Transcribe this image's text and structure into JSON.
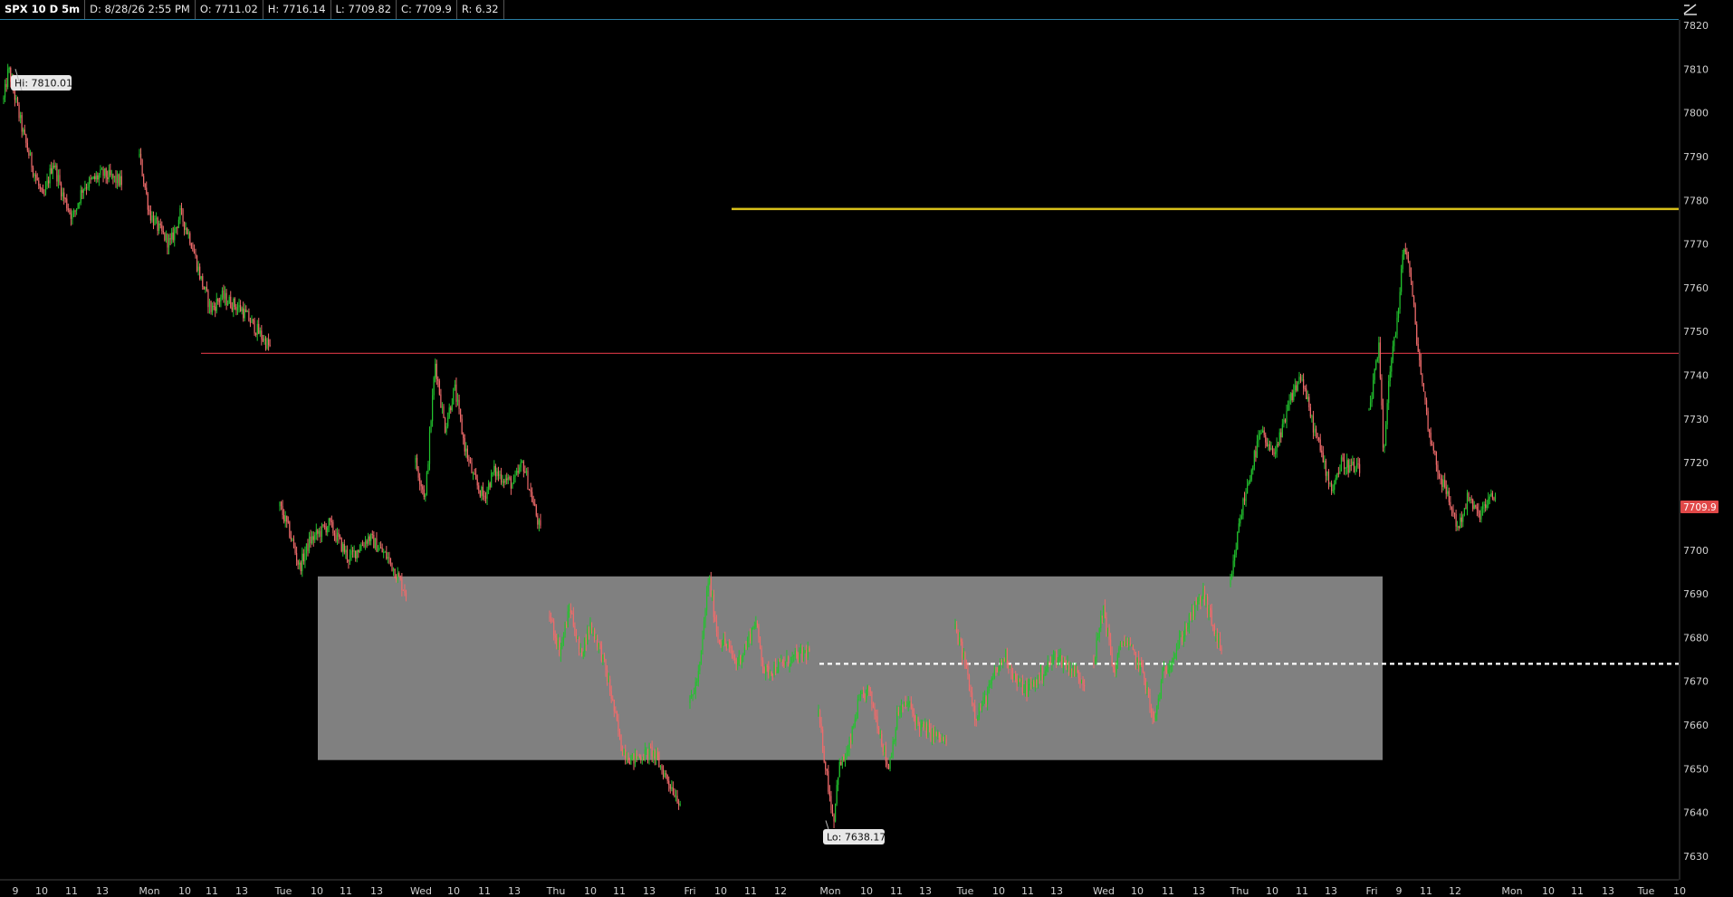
{
  "header": {
    "symbol": "SPX 10 D 5m",
    "date": "D: 8/28/26 2:55 PM",
    "open": "O: 7711.02",
    "high": "H: 7716.14",
    "low": "L: 7709.82",
    "close": "C: 7709.9",
    "range": "R: 6.32"
  },
  "icons": {
    "corner": "drawing-tools-icon"
  },
  "colors": {
    "background": "#000000",
    "up": "#22c32e",
    "down": "#f06b6b",
    "resistance_line": "#d8c01a",
    "support_line": "#c0303c",
    "zone": "#808080",
    "dotted_level": "#ffffff",
    "price_tag": "#e04848"
  },
  "chart_data": {
    "type": "candlestick",
    "title": "SPX 10 D 5m",
    "ylim": [
      7625,
      7830
    ],
    "y_ticks": [
      7630,
      7640,
      7650,
      7660,
      7670,
      7680,
      7690,
      7700,
      7710,
      7720,
      7730,
      7740,
      7750,
      7760,
      7770,
      7780,
      7790,
      7800,
      7810,
      7820
    ],
    "x_tick_labels": [
      "9",
      "10",
      "11",
      "13",
      "Mon",
      "10",
      "11",
      "13",
      "Tue",
      "10",
      "11",
      "13",
      "Wed",
      "10",
      "11",
      "13",
      "Thu",
      "10",
      "11",
      "13",
      "Fri",
      "10",
      "11",
      "12",
      "Mon",
      "10",
      "11",
      "13",
      "Tue",
      "10",
      "11",
      "13",
      "Wed",
      "10",
      "11",
      "13",
      "Thu",
      "10",
      "11",
      "13",
      "Fri",
      "9",
      "11",
      "12",
      "Mon",
      "10",
      "11",
      "13",
      "Tue",
      "10"
    ],
    "price_path": [
      [
        "Fri 9:30",
        7803
      ],
      [
        "Fri 9:45",
        7810
      ],
      [
        "Fri 10:30",
        7795
      ],
      [
        "Fri 11:00",
        7787
      ],
      [
        "Fri 11:30",
        7780
      ],
      [
        "Fri 12:00",
        7789
      ],
      [
        "Fri 12:30",
        7781
      ],
      [
        "Fri 13:00",
        7776
      ],
      [
        "Fri 13:30",
        7783
      ],
      [
        "Fri 14:30",
        7786
      ],
      [
        "Fri 15:30",
        7784
      ],
      [
        "Mon 9:30",
        7790
      ],
      [
        "Mon 10:00",
        7777
      ],
      [
        "Mon 10:30",
        7773
      ],
      [
        "Mon 11:00",
        7770
      ],
      [
        "Mon 11:30",
        7777
      ],
      [
        "Mon 12:00",
        7771
      ],
      [
        "Mon 12:30",
        7762
      ],
      [
        "Mon 13:00",
        7755
      ],
      [
        "Mon 13:30",
        7758
      ],
      [
        "Mon 14:30",
        7755
      ],
      [
        "Mon 15:55",
        7746
      ],
      [
        "Tue 9:30",
        7710
      ],
      [
        "Tue 10:00",
        7704
      ],
      [
        "Tue 10:30",
        7696
      ],
      [
        "Tue 11:00",
        7702
      ],
      [
        "Tue 12:00",
        7706
      ],
      [
        "Tue 13:00",
        7698
      ],
      [
        "Tue 14:00",
        7703
      ],
      [
        "Tue 15:00",
        7698
      ],
      [
        "Tue 15:55",
        7690
      ],
      [
        "Wed 9:30",
        7720
      ],
      [
        "Wed 10:00",
        7712
      ],
      [
        "Wed 10:30",
        7743
      ],
      [
        "Wed 11:00",
        7728
      ],
      [
        "Wed 11:30",
        7737
      ],
      [
        "Wed 12:00",
        7724
      ],
      [
        "Wed 12:30",
        7716
      ],
      [
        "Wed 13:00",
        7712
      ],
      [
        "Wed 13:30",
        7718
      ],
      [
        "Wed 14:30",
        7715
      ],
      [
        "Wed 15:00",
        7720
      ],
      [
        "Wed 15:55",
        7704
      ],
      [
        "Thu 9:30",
        7685
      ],
      [
        "Thu 10:00",
        7677
      ],
      [
        "Thu 10:30",
        7687
      ],
      [
        "Thu 11:00",
        7676
      ],
      [
        "Thu 11:30",
        7683
      ],
      [
        "Thu 12:00",
        7677
      ],
      [
        "Thu 12:30",
        7667
      ],
      [
        "Thu 13:00",
        7655
      ],
      [
        "Thu 13:30",
        7652
      ],
      [
        "Thu 14:30",
        7654
      ],
      [
        "Thu 15:55",
        7642
      ],
      [
        "Fri 9:30",
        7665
      ],
      [
        "Fri 10:00",
        7672
      ],
      [
        "Fri 10:30",
        7694
      ],
      [
        "Fri 11:00",
        7680
      ],
      [
        "Fri 11:30",
        7678
      ],
      [
        "Fri 12:00",
        7674
      ],
      [
        "Fri 12:30",
        7678
      ],
      [
        "Fri 13:00",
        7684
      ],
      [
        "Fri 13:30",
        7672
      ],
      [
        "Fri 15:55",
        7677
      ],
      [
        "Mon 9:30",
        7662
      ],
      [
        "Mon 10:00",
        7646
      ],
      [
        "Mon 10:15",
        7638
      ],
      [
        "Mon 10:30",
        7650
      ],
      [
        "Mon 11:00",
        7654
      ],
      [
        "Mon 11:30",
        7665
      ],
      [
        "Mon 12:00",
        7668
      ],
      [
        "Mon 12:30",
        7660
      ],
      [
        "Mon 13:00",
        7650
      ],
      [
        "Mon 13:30",
        7663
      ],
      [
        "Mon 14:00",
        7665
      ],
      [
        "Mon 14:30",
        7660
      ],
      [
        "Mon 15:55",
        7656
      ],
      [
        "Tue 9:30",
        7682
      ],
      [
        "Tue 10:00",
        7674
      ],
      [
        "Tue 10:30",
        7662
      ],
      [
        "Tue 11:00",
        7666
      ],
      [
        "Tue 11:30",
        7672
      ],
      [
        "Tue 12:00",
        7676
      ],
      [
        "Tue 12:30",
        7670
      ],
      [
        "Tue 13:00",
        7668
      ],
      [
        "Tue 13:30",
        7670
      ],
      [
        "Tue 14:30",
        7676
      ],
      [
        "Tue 15:55",
        7670
      ],
      [
        "Wed 9:30",
        7675
      ],
      [
        "Wed 10:00",
        7687
      ],
      [
        "Wed 10:30",
        7672
      ],
      [
        "Wed 11:00",
        7680
      ],
      [
        "Wed 11:30",
        7676
      ],
      [
        "Wed 12:00",
        7672
      ],
      [
        "Wed 12:30",
        7660
      ],
      [
        "Wed 13:00",
        7672
      ],
      [
        "Wed 13:30",
        7676
      ],
      [
        "Wed 14:30",
        7686
      ],
      [
        "Wed 15:00",
        7690
      ],
      [
        "Wed 15:55",
        7676
      ],
      [
        "Thu 9:30",
        7692
      ],
      [
        "Thu 10:00",
        7708
      ],
      [
        "Thu 10:30",
        7718
      ],
      [
        "Thu 11:00",
        7727
      ],
      [
        "Thu 11:30",
        7722
      ],
      [
        "Thu 12:00",
        7726
      ],
      [
        "Thu 12:30",
        7735
      ],
      [
        "Thu 13:00",
        7740
      ],
      [
        "Thu 13:30",
        7730
      ],
      [
        "Thu 14:00",
        7722
      ],
      [
        "Thu 14:30",
        7714
      ],
      [
        "Thu 15:00",
        7720
      ],
      [
        "Thu 15:55",
        7718
      ],
      [
        "Fri 9:30",
        7732
      ],
      [
        "Fri 10:00",
        7746
      ],
      [
        "Fri 10:15",
        7720
      ],
      [
        "Fri 10:30",
        7740
      ],
      [
        "Fri 11:00",
        7755
      ],
      [
        "Fri 11:15",
        7770
      ],
      [
        "Fri 11:30",
        7766
      ],
      [
        "Fri 12:00",
        7745
      ],
      [
        "Fri 12:30",
        7728
      ],
      [
        "Fri 13:00",
        7718
      ],
      [
        "Fri 13:30",
        7712
      ],
      [
        "Fri 14:00",
        7705
      ],
      [
        "Fri 14:30",
        7712
      ],
      [
        "Fri 15:00",
        7708
      ],
      [
        "Fri 15:55",
        7713
      ]
    ],
    "last_price": "7709.9",
    "annotations": [
      {
        "label": "Hi: 7810.01",
        "value": 7810.01
      },
      {
        "label": "Lo: 7638.17",
        "value": 7638.17
      }
    ],
    "horizontal_lines": [
      {
        "kind": "resistance",
        "value": 7778
      },
      {
        "kind": "support",
        "value": 7745
      },
      {
        "kind": "dotted",
        "value": 7674
      }
    ],
    "zone": {
      "low": 7652,
      "high": 7694
    }
  }
}
